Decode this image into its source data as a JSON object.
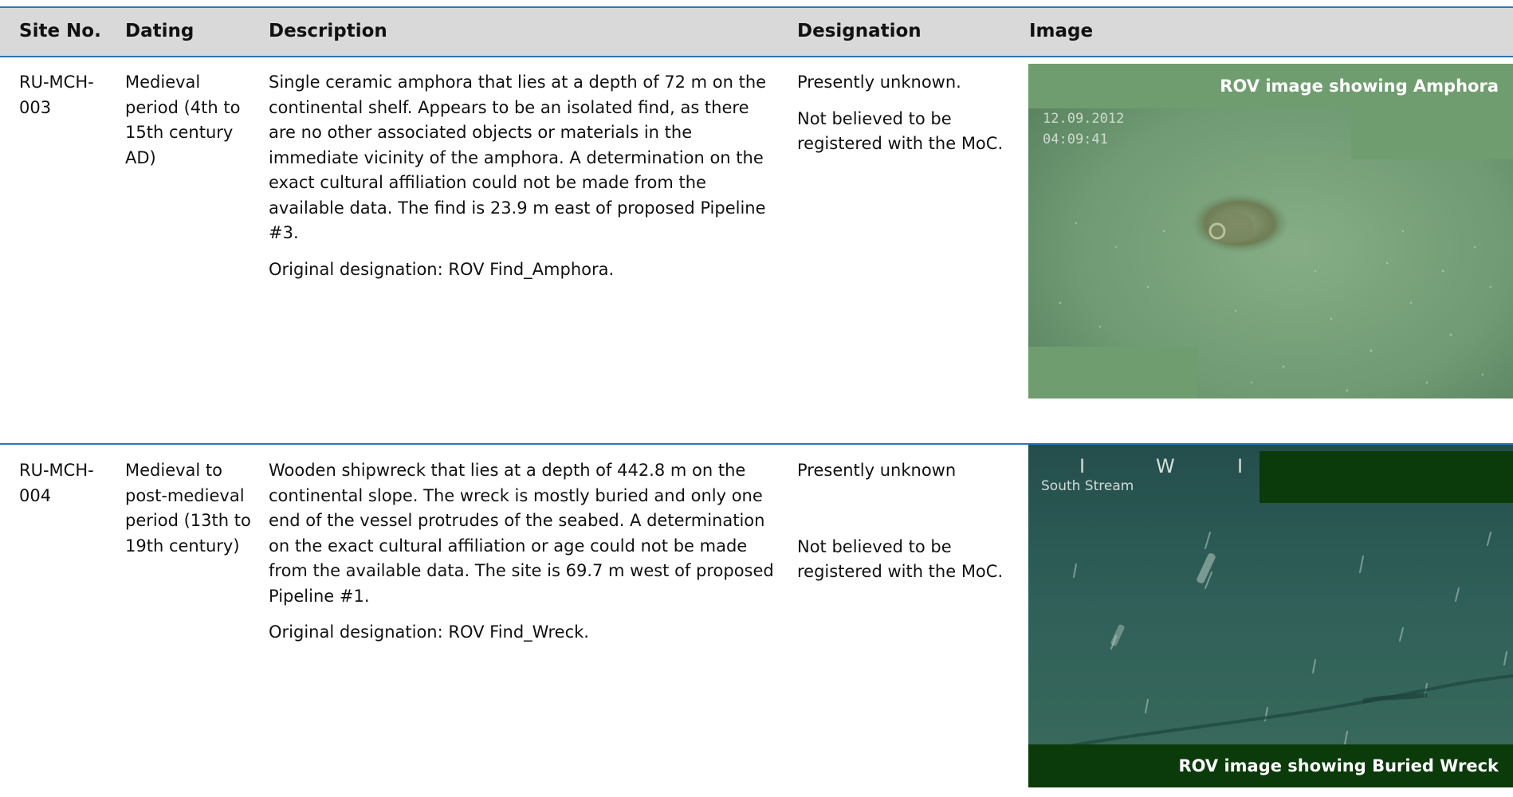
{
  "table": {
    "headers": {
      "site_no": "Site No.",
      "dating": "Dating",
      "description": "Description",
      "designation": "Designation",
      "image": "Image"
    },
    "rows": [
      {
        "site_no": "RU-MCH-003",
        "dating": "Medieval period (4th to 15th century AD)",
        "description": "Single ceramic amphora that lies at a depth of 72 m on the continental shelf. Appears to be an isolated find, as there are no other associated objects or materials in the immediate vicinity of the amphora. A determination on the exact cultural affiliation could not be made from the available data. The find is 23.9 m east of proposed Pipeline #3.",
        "original_designation": "Original designation: ROV Find_Amphora.",
        "designation_1": "Presently unknown.",
        "designation_2": "Not believed to be registered with the MoC.",
        "image": {
          "caption": "ROV image showing Amphora",
          "osd_date": "12.09.2012",
          "osd_time": "04:09:41",
          "colors": {
            "seabed": "#6e9a72",
            "caption_box": "#6f9d6f"
          }
        }
      },
      {
        "site_no": "RU-MCH-004",
        "dating": "Medieval to post-medieval period (13th to 19th century)",
        "description": "Wooden shipwreck that lies at a depth of 442.8 m on the continental slope. The wreck is mostly buried and only one end of the vessel protrudes of the seabed. A determination on the exact cultural affiliation or age could not be made from the available data. The site is 69.7 m west of proposed Pipeline #1.",
        "original_designation": "Original designation: ROV Find_Wreck.",
        "designation_1": "Presently unknown",
        "designation_2": "Not believed to be registered with the MoC.",
        "image": {
          "caption": "ROV image showing Buried Wreck",
          "osd_label": "South Stream",
          "osd_markers": [
            "I",
            "W",
            "I"
          ],
          "colors": {
            "seabed": "#2f5f58",
            "caption_box": "#0b3a0b"
          }
        }
      }
    ]
  },
  "colors": {
    "header_bg": "#d9d9d9",
    "rule": "#2e75b6"
  }
}
